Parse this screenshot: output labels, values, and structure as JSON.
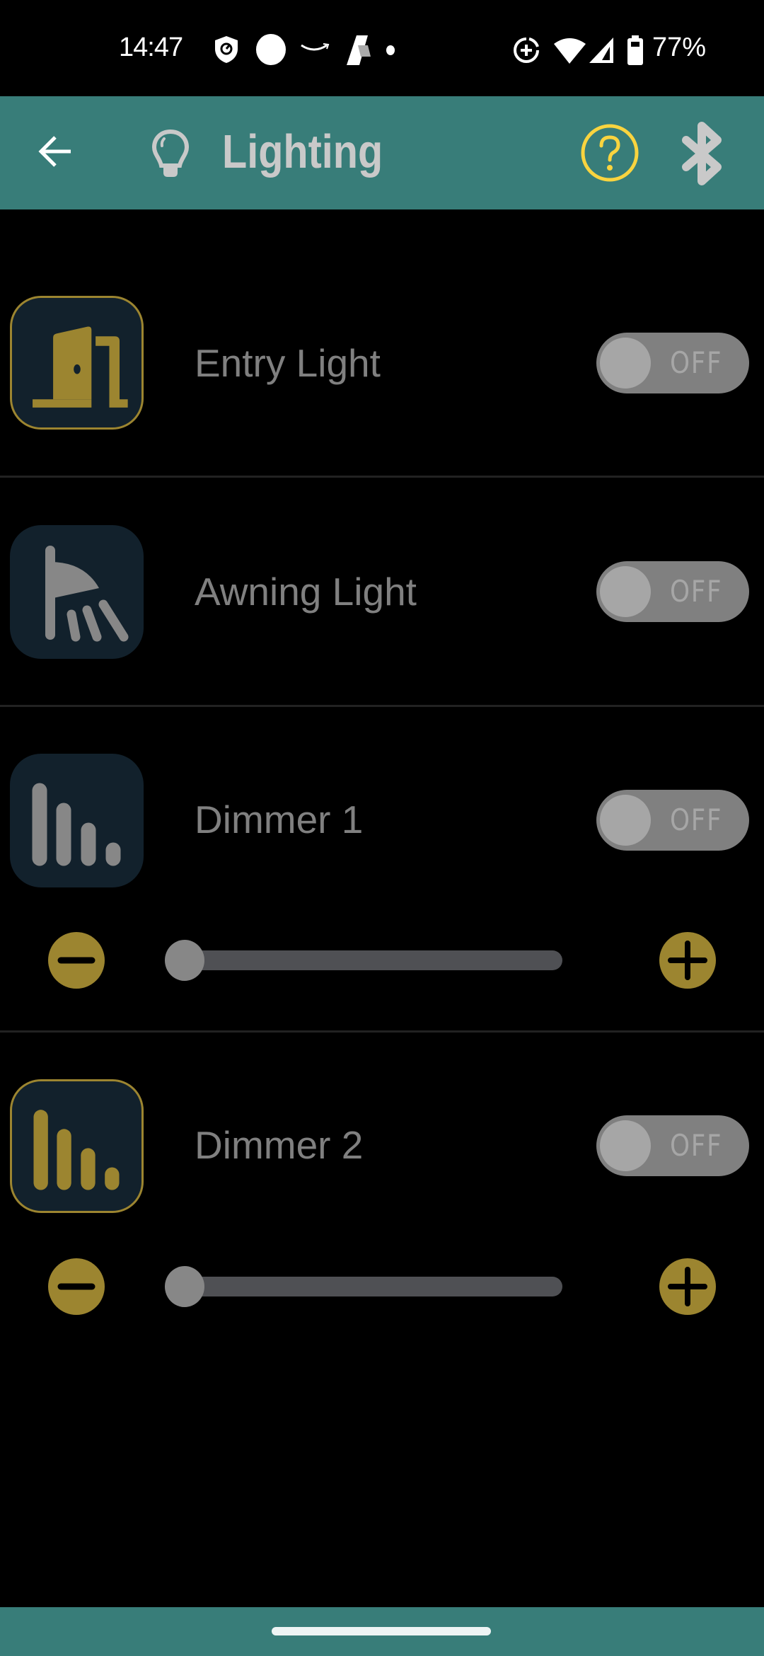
{
  "status_bar": {
    "time": "14:47",
    "battery_percent": "77%",
    "left_icons": [
      "shield-check-icon",
      "circle-icon",
      "amazon-smile-icon",
      "app-a-icon",
      "dot-icon"
    ],
    "right_icons": [
      "data-saver-icon",
      "wifi-icon",
      "signal-icon",
      "battery-icon"
    ]
  },
  "app_bar": {
    "title": "Lighting",
    "back_icon": "arrow-left-icon",
    "title_icon": "lightbulb-icon",
    "help_icon": "help-circle-icon",
    "bluetooth_icon": "bluetooth-icon"
  },
  "colors": {
    "teal": "#387D79",
    "gold": "#9C8530",
    "help_yellow": "#F9D43F",
    "icon_bg": "#12212C",
    "label_gray": "#808080"
  },
  "devices": [
    {
      "name": "Entry Light",
      "icon": "door-icon",
      "active_icon": true,
      "toggle": "OFF"
    },
    {
      "name": "Awning Light",
      "icon": "shower-light-icon",
      "active_icon": false,
      "toggle": "OFF"
    },
    {
      "name": "Dimmer 1",
      "icon": "dimmer-bars-icon",
      "active_icon": false,
      "toggle": "OFF",
      "level_percent": 0
    },
    {
      "name": "Dimmer 2",
      "icon": "dimmer-bars-icon",
      "active_icon": true,
      "toggle": "OFF",
      "level_percent": 0
    }
  ]
}
